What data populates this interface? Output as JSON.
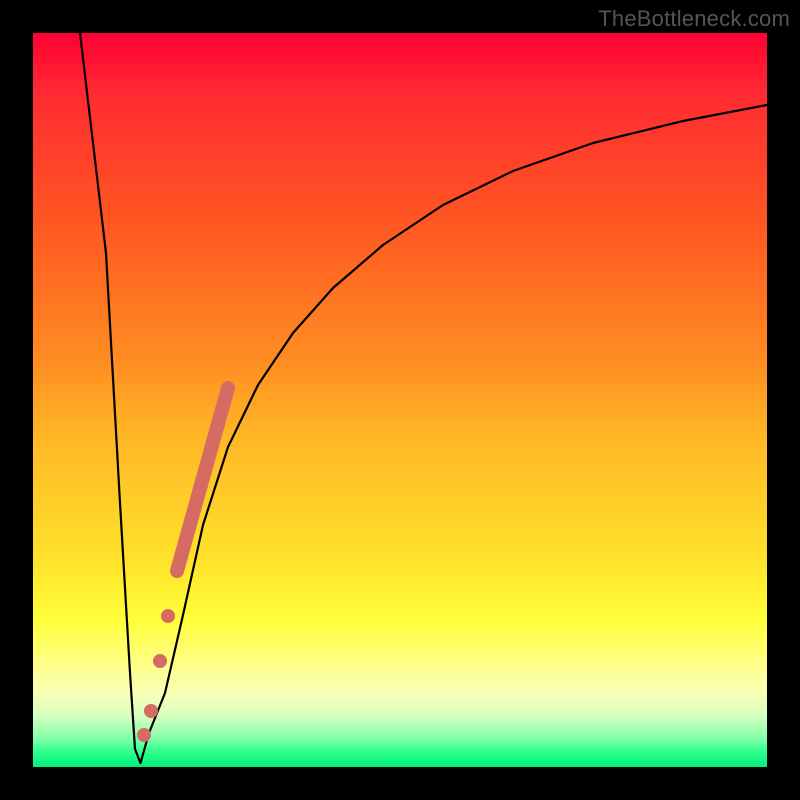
{
  "watermark": "TheBottleneck.com",
  "colors": {
    "background_frame": "#000000",
    "curve": "#000000",
    "overlay": "#d66b63"
  },
  "chart_data": {
    "type": "line",
    "title": "",
    "xlabel": "",
    "ylabel": "",
    "xlim": [
      0,
      100
    ],
    "ylim": [
      0,
      100
    ],
    "series": [
      {
        "name": "bottleneck-curve",
        "x": [
          7,
          9,
          11,
          12.5,
          13.5,
          14.5,
          16,
          18,
          20,
          22,
          24,
          27,
          30,
          34,
          40,
          48,
          58,
          70,
          85,
          100
        ],
        "y": [
          100,
          60,
          22,
          4,
          0,
          3,
          10,
          22,
          34,
          44,
          51,
          58,
          64,
          70,
          76,
          82,
          86.5,
          89.5,
          91.5,
          92.5
        ]
      }
    ],
    "overlay": {
      "name": "highlight-range",
      "segment": {
        "x": [
          18.5,
          25
        ],
        "y": [
          26,
          52
        ]
      },
      "dots": [
        {
          "x": 14.8,
          "y": 4
        },
        {
          "x": 15.8,
          "y": 8
        },
        {
          "x": 17.0,
          "y": 15
        },
        {
          "x": 17.8,
          "y": 21
        }
      ]
    }
  }
}
